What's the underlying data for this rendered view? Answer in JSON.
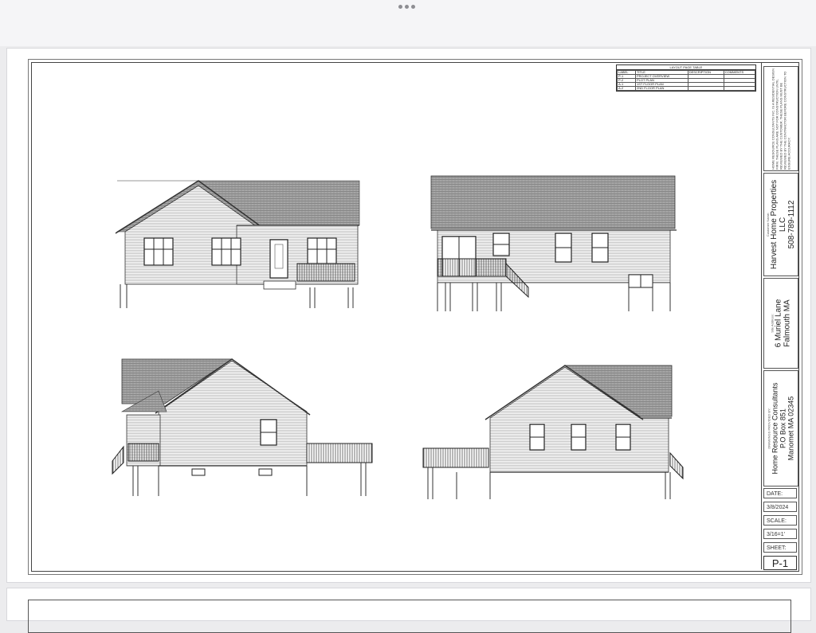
{
  "viewer": {
    "menu_icon": "more-dots-icon"
  },
  "layout_table": {
    "title": "LAYOUT PAGE TABLE",
    "headers": [
      "LABEL",
      "TITLE",
      "DESCRIPTION",
      "COMMENTS"
    ],
    "rows": [
      [
        "P-1",
        "PROJECT OVERVIEW",
        "",
        ""
      ],
      [
        "P-2",
        "PLOT PLAN",
        "",
        ""
      ],
      [
        "A-1",
        "1ST FLOOR PLAN",
        "",
        ""
      ],
      [
        "A-2",
        "2ND FLOOR PLAN",
        "",
        ""
      ]
    ]
  },
  "title_block": {
    "disclaimer": "HOME RESOURCE CONSULTANTS INC. IS A RESIDENTIAL DESIGN FIRM. THESE PLANS ARE NOT FOR CONSTRUCTION UNTIL REVIEWED BY THE CUSTOMER. THESE PLANS MUST BE REVIEWED BY THE CONTRACTOR BEFORE CONSTRUCTION TO ENSURE ACCURACY.",
    "customer_label": "Customer Name:",
    "customer_name_line1": "Harvest Home Properties",
    "customer_name_line2": "LLC",
    "customer_phone": "508-789-1112",
    "site_label": "Site Address:",
    "site_line1": "6 Muriel Lane",
    "site_line2": "Falmouth MA",
    "provider_label": "DRAWINGS PROVIDED BY:",
    "provider_line1": "Home Resource Consultants",
    "provider_line2": "P.O Box 851",
    "provider_line3": "Manomet MA 02345",
    "date_label": "DATE:",
    "date_value": "3/8/2024",
    "scale_label": "SCALE:",
    "scale_value": "3/16=1'",
    "sheet_label": "SHEET:",
    "sheet_value": "P-1"
  },
  "colors": {
    "roof": "#9a9a9a",
    "siding": "#cfcfcf",
    "line": "#333333"
  }
}
